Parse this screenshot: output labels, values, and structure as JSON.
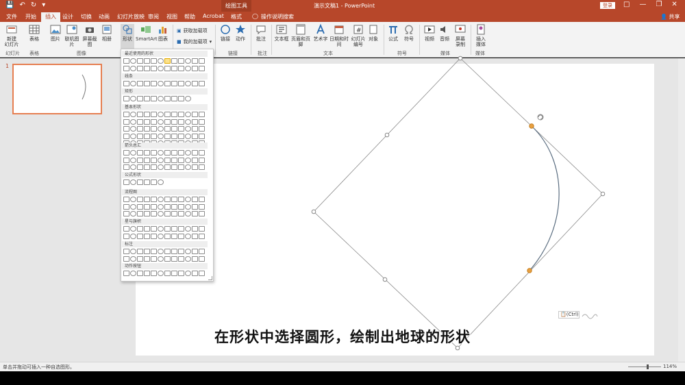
{
  "titlebar": {
    "context_tab": "绘图工具",
    "doc_title": "演示文稿1 - PowerPoint",
    "login": "登录"
  },
  "tabs": [
    "文件",
    "开始",
    "插入",
    "设计",
    "切换",
    "动画",
    "幻灯片放映",
    "审阅",
    "视图",
    "帮助",
    "Acrobat",
    "格式"
  ],
  "active_tab": "插入",
  "search_hint": "操作说明搜索",
  "share": "共享",
  "ribbon": {
    "new_slide": "新建\n幻灯片",
    "table": "表格",
    "picture": "图片",
    "online_picture": "联机图片",
    "screenshot": "屏幕截图",
    "album": "相册",
    "shapes": "形状",
    "smartart": "SmartArt",
    "chart": "图表",
    "get_addins": "获取加载项",
    "my_addins": "我的加载项",
    "link": "链接",
    "action": "动作",
    "comment": "批注",
    "textbox": "文本框",
    "header_footer": "页眉和页脚",
    "wordart": "艺术字",
    "date_time": "日期和时间",
    "slide_number": "幻灯片\n编号",
    "object": "对象",
    "equation": "公式",
    "symbol": "符号",
    "video": "视频",
    "audio": "音频",
    "screen_record": "屏幕\n录制",
    "insert_media": "插入\n媒体",
    "groups": {
      "slides": "幻灯片",
      "tables": "表格",
      "images": "图像",
      "links": "链接",
      "comments": "批注",
      "text": "文本",
      "symbols": "符号",
      "media": "媒体",
      "media2": "媒体"
    }
  },
  "gallery": {
    "sections": [
      "最近使用的形状",
      "线条",
      "矩形",
      "基本形状",
      "箭头总汇",
      "公式形状",
      "流程图",
      "星与旗帜",
      "标注",
      "动作按钮"
    ]
  },
  "slides_panel": {
    "number": "1"
  },
  "paste_badge": "(Ctrl)",
  "subtitle": "在形状中选择圆形，绘制出地球的形状",
  "status": {
    "hint": "单击并拖动可插入一种自选图形。",
    "zoom": "114%"
  }
}
